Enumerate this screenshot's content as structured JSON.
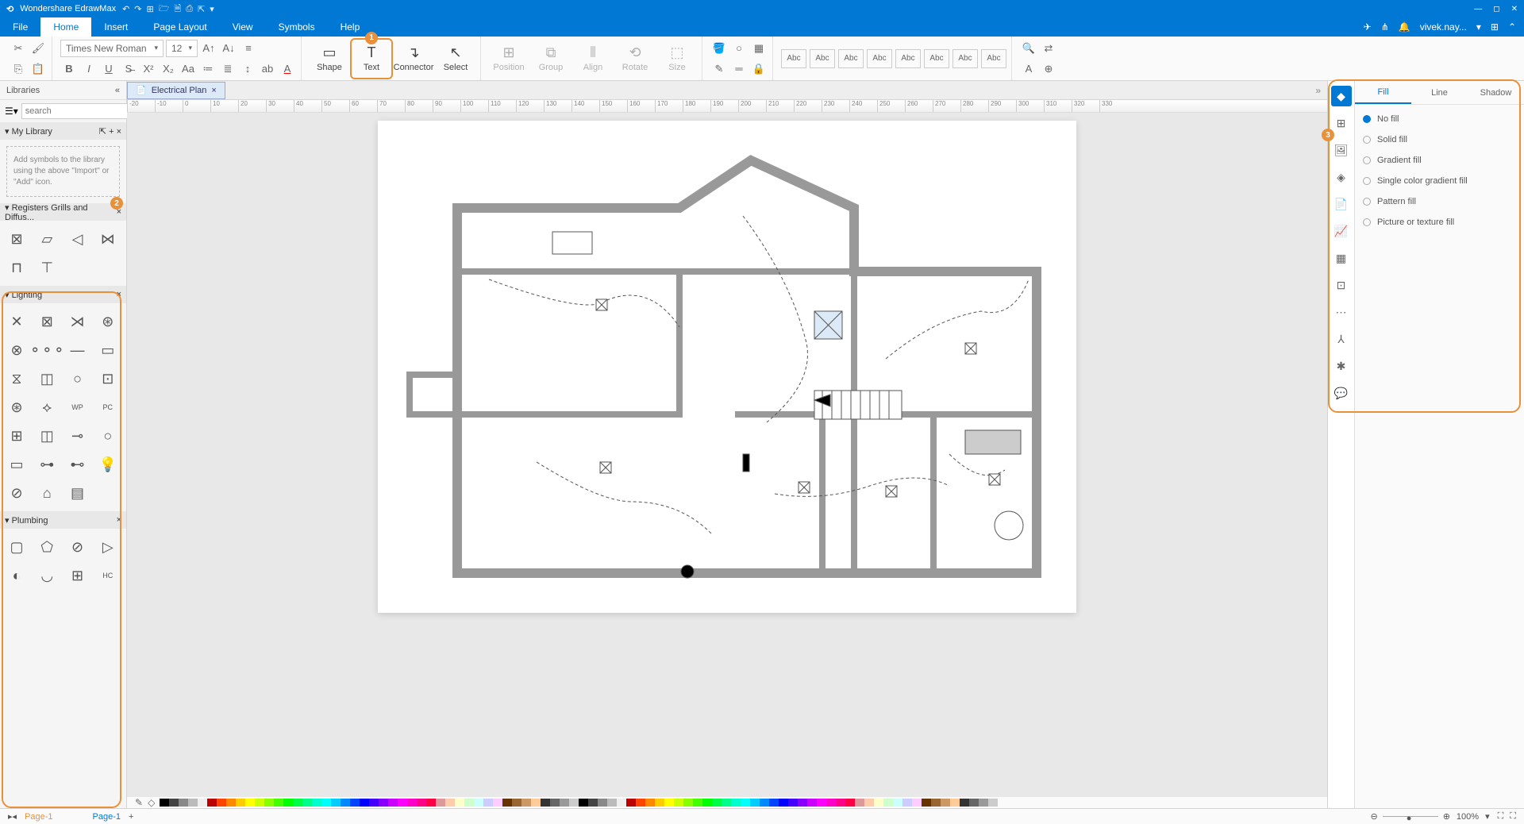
{
  "app": {
    "title": "Wondershare EdrawMax",
    "user": "vivek.nay..."
  },
  "menu": {
    "items": [
      "File",
      "Home",
      "Insert",
      "Page Layout",
      "View",
      "Symbols",
      "Help"
    ],
    "active": 1
  },
  "ribbon": {
    "font_name": "Times New Roman",
    "font_size": "12",
    "tools": {
      "shape": "Shape",
      "text": "Text",
      "connector": "Connector",
      "select": "Select",
      "position": "Position",
      "group": "Group",
      "align": "Align",
      "rotate": "Rotate",
      "size": "Size"
    },
    "abc": "Abc"
  },
  "callouts": {
    "c1": "1",
    "c2": "2",
    "c3": "3"
  },
  "doc": {
    "tab_name": "Electrical Plan",
    "page_label": "Page-1"
  },
  "libraries": {
    "title": "Libraries",
    "search_placeholder": "search",
    "my_library": "My Library",
    "hint": "Add symbols to the library using the above \"Import\" or \"Add\" icon.",
    "sections": {
      "registers": "Registers Grills and Diffus...",
      "lighting": "Lighting",
      "plumbing": "Plumbing"
    }
  },
  "right": {
    "tabs": [
      "Fill",
      "Line",
      "Shadow"
    ],
    "active_tab": 0,
    "options": [
      "No fill",
      "Solid fill",
      "Gradient fill",
      "Single color gradient fill",
      "Pattern fill",
      "Picture or texture fill"
    ],
    "selected": 0
  },
  "status": {
    "zoom": "100%"
  },
  "colors": [
    "#000",
    "#444",
    "#888",
    "#bbb",
    "#eee",
    "#b00",
    "#f40",
    "#f80",
    "#fc0",
    "#ff0",
    "#cf0",
    "#8f0",
    "#4f0",
    "#0f0",
    "#0f4",
    "#0f8",
    "#0fc",
    "#0ff",
    "#0cf",
    "#08f",
    "#04f",
    "#00f",
    "#40f",
    "#80f",
    "#c0f",
    "#f0f",
    "#f0c",
    "#f08",
    "#f04",
    "#d99",
    "#fca",
    "#ffc",
    "#cfc",
    "#cff",
    "#ccf",
    "#fcf",
    "#630",
    "#963",
    "#c96",
    "#fc9",
    "#333",
    "#666",
    "#999",
    "#ccc"
  ]
}
